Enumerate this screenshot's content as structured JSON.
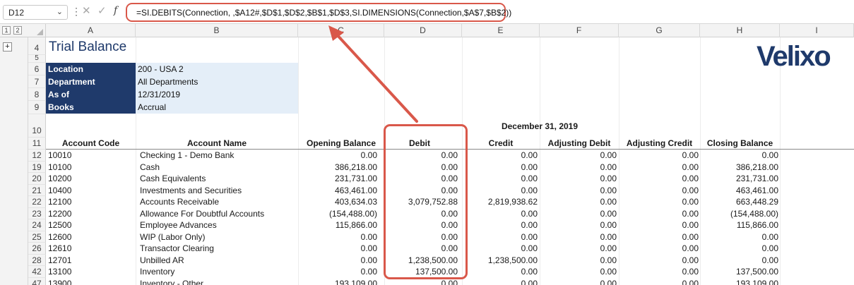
{
  "formula_bar": {
    "name_box": "D12",
    "formula": "=SI.DEBITS(Connection, ,$A12#,$D$1,$D$2,$B$1,$D$3,SI.DIMENSIONS(Connection,$A$7,$B$2))"
  },
  "outline": {
    "levels": [
      "1",
      "2"
    ],
    "expand": "+"
  },
  "columns": [
    "A",
    "B",
    "C",
    "D",
    "E",
    "F",
    "G",
    "H",
    "I"
  ],
  "title_row": "4",
  "blank_row": "5",
  "report": {
    "title": "Trial Balance",
    "filters": [
      {
        "row": "6",
        "label": "Location",
        "value": "200 - USA 2"
      },
      {
        "row": "7",
        "label": "Department",
        "value": "All Departments"
      },
      {
        "row": "8",
        "label": "As of",
        "value": "12/31/2019"
      },
      {
        "row": "9",
        "label": "Books",
        "value": "Accrual"
      }
    ],
    "logo": "Velixo",
    "period_row": "10",
    "period_label": "December 31, 2019",
    "header_row": "11",
    "headers": [
      "Account Code",
      "Account Name",
      "Opening Balance",
      "Debit",
      "Credit",
      "Adjusting Debit",
      "Adjusting Credit",
      "Closing Balance"
    ],
    "rows": [
      {
        "row": "12",
        "code": "10010",
        "name": "Checking 1 - Demo Bank",
        "opening": "0.00",
        "debit": "0.00",
        "credit": "0.00",
        "adj_debit": "0.00",
        "adj_credit": "0.00",
        "closing": "0.00"
      },
      {
        "row": "19",
        "code": "10100",
        "name": "Cash",
        "opening": "386,218.00",
        "debit": "0.00",
        "credit": "0.00",
        "adj_debit": "0.00",
        "adj_credit": "0.00",
        "closing": "386,218.00"
      },
      {
        "row": "20",
        "code": "10200",
        "name": "Cash Equivalents",
        "opening": "231,731.00",
        "debit": "0.00",
        "credit": "0.00",
        "adj_debit": "0.00",
        "adj_credit": "0.00",
        "closing": "231,731.00"
      },
      {
        "row": "21",
        "code": "10400",
        "name": "Investments and Securities",
        "opening": "463,461.00",
        "debit": "0.00",
        "credit": "0.00",
        "adj_debit": "0.00",
        "adj_credit": "0.00",
        "closing": "463,461.00"
      },
      {
        "row": "22",
        "code": "12100",
        "name": "Accounts Receivable",
        "opening": "403,634.03",
        "debit": "3,079,752.88",
        "credit": "2,819,938.62",
        "adj_debit": "0.00",
        "adj_credit": "0.00",
        "closing": "663,448.29"
      },
      {
        "row": "23",
        "code": "12200",
        "name": "Allowance For Doubtful Accounts",
        "opening": "(154,488.00)",
        "debit": "0.00",
        "credit": "0.00",
        "adj_debit": "0.00",
        "adj_credit": "0.00",
        "closing": "(154,488.00)"
      },
      {
        "row": "24",
        "code": "12500",
        "name": "Employee Advances",
        "opening": "115,866.00",
        "debit": "0.00",
        "credit": "0.00",
        "adj_debit": "0.00",
        "adj_credit": "0.00",
        "closing": "115,866.00"
      },
      {
        "row": "25",
        "code": "12600",
        "name": "WIP (Labor Only)",
        "opening": "0.00",
        "debit": "0.00",
        "credit": "0.00",
        "adj_debit": "0.00",
        "adj_credit": "0.00",
        "closing": "0.00"
      },
      {
        "row": "26",
        "code": "12610",
        "name": "Transactor Clearing",
        "opening": "0.00",
        "debit": "0.00",
        "credit": "0.00",
        "adj_debit": "0.00",
        "adj_credit": "0.00",
        "closing": "0.00"
      },
      {
        "row": "28",
        "code": "12701",
        "name": "Unbilled AR",
        "opening": "0.00",
        "debit": "1,238,500.00",
        "credit": "1,238,500.00",
        "adj_debit": "0.00",
        "adj_credit": "0.00",
        "closing": "0.00"
      },
      {
        "row": "42",
        "code": "13100",
        "name": "Inventory",
        "opening": "0.00",
        "debit": "137,500.00",
        "credit": "0.00",
        "adj_debit": "0.00",
        "adj_credit": "0.00",
        "closing": "137,500.00"
      },
      {
        "row": "47",
        "code": "13900",
        "name": "Inventory - Other",
        "opening": "193,109.00",
        "debit": "0.00",
        "credit": "0.00",
        "adj_debit": "0.00",
        "adj_credit": "0.00",
        "closing": "193,109.00"
      }
    ]
  },
  "colors": {
    "navy": "#1f3a6b",
    "filter_fill": "#e4eef8",
    "callout": "#d9584a"
  }
}
